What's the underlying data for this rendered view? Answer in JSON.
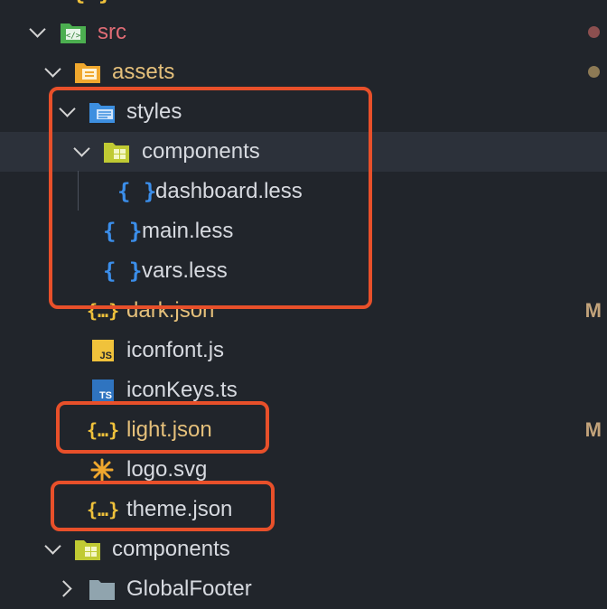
{
  "tree": {
    "src": {
      "label": "src"
    },
    "assets": {
      "label": "assets"
    },
    "styles": {
      "label": "styles"
    },
    "styles_components": {
      "label": "components"
    },
    "dashboard_less": {
      "label": "dashboard.less"
    },
    "main_less": {
      "label": "main.less"
    },
    "vars_less": {
      "label": "vars.less"
    },
    "dark_json": {
      "label": "dark.json",
      "status": "M"
    },
    "iconfont_js": {
      "label": "iconfont.js"
    },
    "iconkeys_ts": {
      "label": "iconKeys.ts"
    },
    "light_json": {
      "label": "light.json",
      "status": "M"
    },
    "logo_svg": {
      "label": "logo.svg"
    },
    "theme_json": {
      "label": "theme.json"
    },
    "components": {
      "label": "components"
    },
    "globalfooter": {
      "label": "GlobalFooter"
    }
  },
  "icons": {
    "js": "JS",
    "ts": "TS",
    "json_braces": "{…}",
    "less_braces": "{ }"
  },
  "colors": {
    "background": "#21252b",
    "modified": "#e5c07b",
    "src": "#e06c75",
    "default_text": "#d7dae0",
    "highlight_box": "#e8502a",
    "less_icon": "#3b8eea",
    "json_icon": "#f0c23b"
  }
}
